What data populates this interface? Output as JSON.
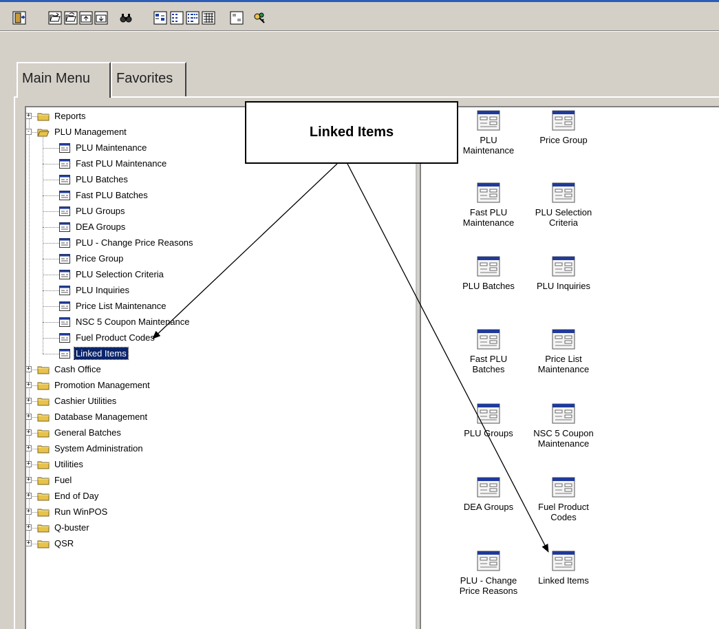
{
  "toolbar": {
    "buttons": [
      {
        "name": "exit-icon"
      },
      {
        "name": "open-folder-icon"
      },
      {
        "name": "open-folder-alt-icon"
      },
      {
        "name": "up-folder-icon"
      },
      {
        "name": "down-folder-icon"
      },
      {
        "name": "find-icon"
      },
      {
        "name": "large-icons-view-icon"
      },
      {
        "name": "small-icons-view-icon"
      },
      {
        "name": "list-view-icon"
      },
      {
        "name": "details-view-icon"
      },
      {
        "name": "tile-view-icon"
      },
      {
        "name": "security-keys-icon"
      }
    ]
  },
  "tabs": [
    {
      "label": "Main Menu",
      "active": true
    },
    {
      "label": "Favorites",
      "active": false
    }
  ],
  "tree": {
    "top_items": [
      {
        "label": "Reports",
        "expanded": false
      },
      {
        "label": "PLU Management",
        "expanded": true
      },
      {
        "label": "Cash Office",
        "expanded": false
      },
      {
        "label": "Promotion Management",
        "expanded": false
      },
      {
        "label": "Cashier Utilities",
        "expanded": false
      },
      {
        "label": "Database Management",
        "expanded": false
      },
      {
        "label": "General Batches",
        "expanded": false
      },
      {
        "label": "System Administration",
        "expanded": false
      },
      {
        "label": "Utilities",
        "expanded": false
      },
      {
        "label": "Fuel",
        "expanded": false
      },
      {
        "label": "End of Day",
        "expanded": false
      },
      {
        "label": "Run WinPOS",
        "expanded": false
      },
      {
        "label": "Q-buster",
        "expanded": false
      },
      {
        "label": "QSR",
        "expanded": false
      }
    ],
    "plu_children": [
      {
        "label": "PLU Maintenance"
      },
      {
        "label": "Fast PLU Maintenance"
      },
      {
        "label": "PLU Batches"
      },
      {
        "label": "Fast PLU Batches"
      },
      {
        "label": "PLU Groups"
      },
      {
        "label": "DEA Groups"
      },
      {
        "label": "PLU - Change Price Reasons"
      },
      {
        "label": "Price Group"
      },
      {
        "label": "PLU Selection Criteria"
      },
      {
        "label": "PLU Inquiries"
      },
      {
        "label": "Price List Maintenance"
      },
      {
        "label": "NSC 5 Coupon Maintenance"
      },
      {
        "label": "Fuel Product Codes"
      },
      {
        "label": "Linked Items",
        "selected": true
      }
    ]
  },
  "icon_pane": {
    "items": [
      {
        "line1": "PLU",
        "line2": "Maintenance"
      },
      {
        "line1": "Price Group",
        "line2": ""
      },
      {
        "line1": "Fast PLU",
        "line2": "Maintenance"
      },
      {
        "line1": "PLU Selection",
        "line2": "Criteria"
      },
      {
        "line1": "PLU Batches",
        "line2": ""
      },
      {
        "line1": "PLU Inquiries",
        "line2": ""
      },
      {
        "line1": "Fast PLU",
        "line2": "Batches"
      },
      {
        "line1": "Price List",
        "line2": "Maintenance"
      },
      {
        "line1": "PLU Groups",
        "line2": ""
      },
      {
        "line1": "NSC 5 Coupon",
        "line2": "Maintenance"
      },
      {
        "line1": "DEA Groups",
        "line2": ""
      },
      {
        "line1": "Fuel Product",
        "line2": "Codes"
      },
      {
        "line1": "PLU - Change",
        "line2": "Price Reasons"
      },
      {
        "line1": "Linked Items",
        "line2": ""
      }
    ]
  },
  "callout": {
    "text": "Linked Items"
  },
  "colors": {
    "selection": "#0a246a",
    "folder": "#e8c24a",
    "icon_header": "#1f3a9a"
  }
}
